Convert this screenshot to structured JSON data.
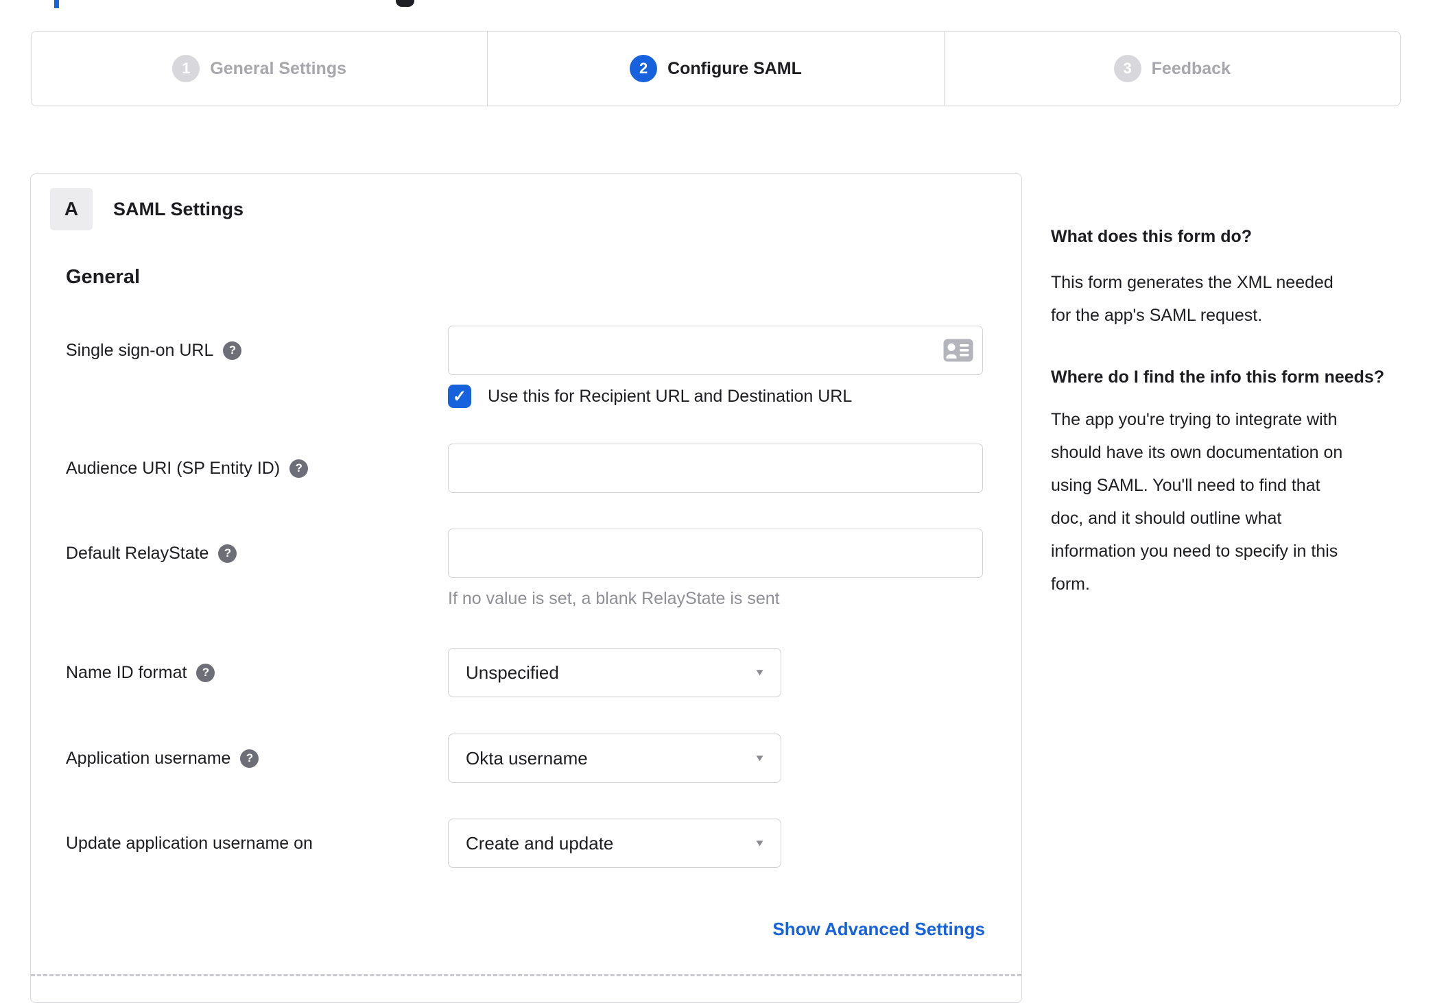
{
  "colors": {
    "accent_blue": "#1662dd",
    "step_inactive_gray": "#d8d8dc",
    "inactive_label_gray": "#a7a7ad",
    "text_dark": "#1d1d21",
    "hint_gray": "#8f8f98",
    "border_gray": "#d2d2d7",
    "help_icon_gray": "#6e6e78",
    "card_icon_gray": "#b4b4bc"
  },
  "icons": {
    "help": "?",
    "check": "✓",
    "caret": "▼"
  },
  "stepper": {
    "steps": [
      {
        "number": "1",
        "label": "General Settings",
        "state": "inactive"
      },
      {
        "number": "2",
        "label": "Configure SAML",
        "state": "active"
      },
      {
        "number": "3",
        "label": "Feedback",
        "state": "inactive"
      }
    ]
  },
  "panel": {
    "section_letter": "A",
    "section_title": "SAML Settings",
    "group_heading": "General",
    "fields": {
      "sso": {
        "label": "Single sign-on URL",
        "value": "",
        "checkbox_label": "Use this for Recipient URL and Destination URL",
        "checked": true
      },
      "audience": {
        "label": "Audience URI (SP Entity ID)",
        "value": ""
      },
      "relay": {
        "label": "Default RelayState",
        "value": "",
        "hint": "If no value is set, a blank RelayState is sent"
      },
      "nameid": {
        "label": "Name ID format",
        "value": "Unspecified"
      },
      "appuser": {
        "label": "Application username",
        "value": "Okta username"
      },
      "update": {
        "label": "Update application username on",
        "value": "Create and update"
      }
    },
    "advanced_link": "Show Advanced Settings"
  },
  "sidebar": {
    "heading1": "What does this form do?",
    "para1": [
      "This form generates the XML needed",
      "for the app's SAML request."
    ],
    "heading2": "Where do I find the info this form needs?",
    "para2": [
      "The app you're trying to integrate with",
      "should have its own documentation on",
      "using SAML. You'll need to find that",
      "doc, and it should outline what",
      "information you need to specify in this",
      "form."
    ]
  }
}
